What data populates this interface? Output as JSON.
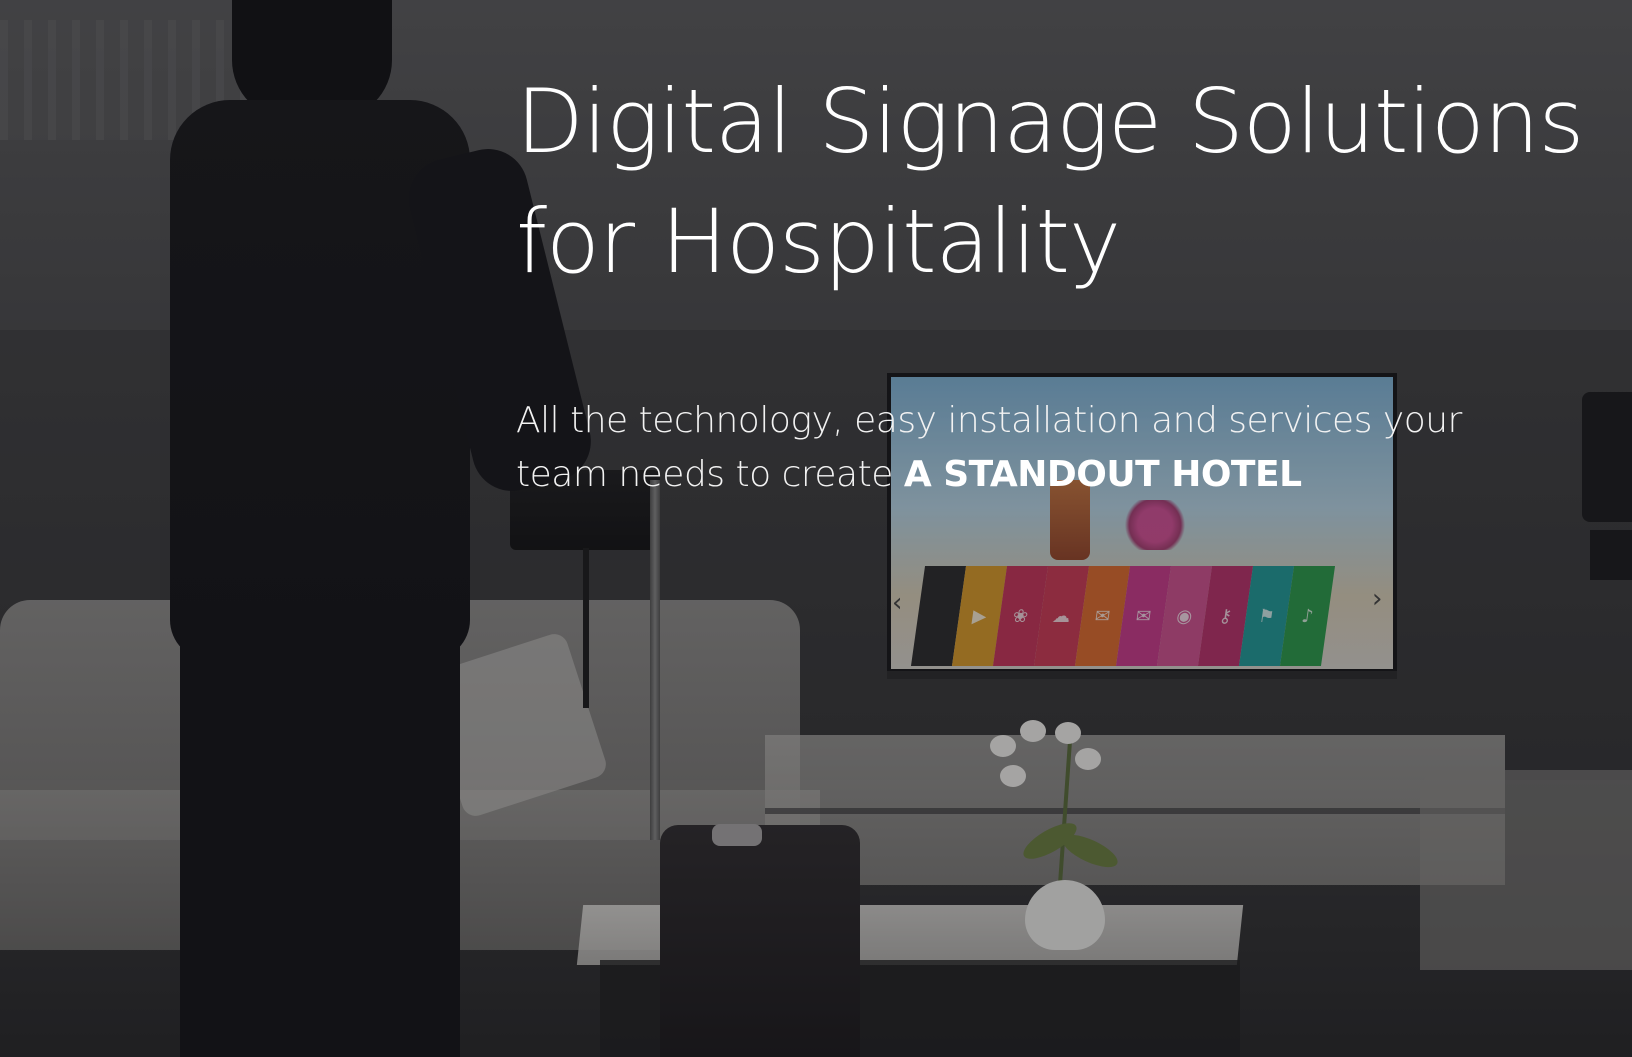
{
  "hero": {
    "title_line1": "Digital Signage Solutions",
    "title_line2": "for Hospitality",
    "subtitle_line1": "All the technology, easy installation and services your",
    "subtitle_line2_prefix": "team needs to create ",
    "subtitle_emphasis": "A STANDOUT HOTEL"
  },
  "scene": {
    "tv_tile_colors": [
      "#2a2a2c",
      "#d99a28",
      "#c7335a",
      "#cc3a55",
      "#de6b2d",
      "#c93a8a",
      "#d0508f",
      "#b9306a",
      "#1f9a98",
      "#2a9a4a"
    ],
    "tv_tile_icons": [
      "",
      "play-icon",
      "bird-icon",
      "cloud-icon",
      "chat-icon",
      "mail-icon",
      "video-icon",
      "key-icon",
      "bookmark-icon",
      "note-icon"
    ],
    "prev_arrow": "‹",
    "next_arrow": "›"
  }
}
